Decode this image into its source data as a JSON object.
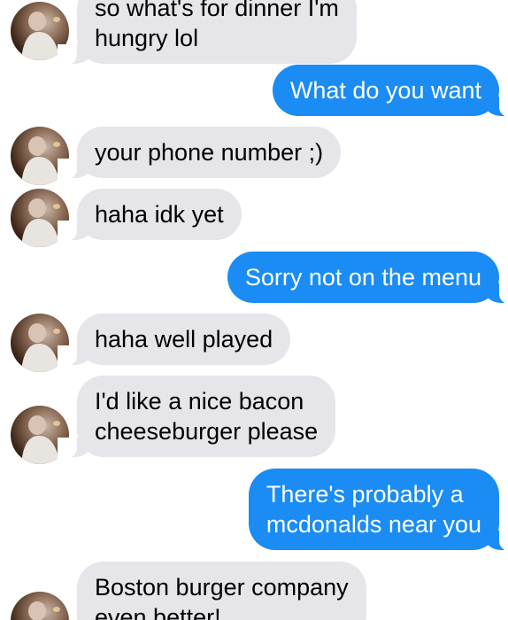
{
  "messages": [
    {
      "direction": "incoming",
      "avatar_icon": "contact-avatar",
      "lines": [
        "so what's for dinner I'm",
        "hungry lol"
      ]
    },
    {
      "direction": "outgoing",
      "lines": [
        "What do you want"
      ]
    },
    {
      "direction": "incoming",
      "avatar_icon": "contact-avatar",
      "lines": [
        "your phone number ;)"
      ]
    },
    {
      "direction": "incoming",
      "avatar_icon": "contact-avatar",
      "lines": [
        "haha idk yet"
      ]
    },
    {
      "direction": "outgoing",
      "lines": [
        "Sorry not on the menu"
      ]
    },
    {
      "direction": "incoming",
      "avatar_icon": "contact-avatar",
      "lines": [
        "haha well played"
      ]
    },
    {
      "direction": "incoming",
      "avatar_icon": "contact-avatar",
      "lines": [
        "I'd like a nice bacon",
        "cheeseburger please"
      ]
    },
    {
      "direction": "outgoing",
      "lines": [
        "There's probably a",
        "mcdonalds near you"
      ]
    },
    {
      "direction": "incoming",
      "avatar_icon": "contact-avatar",
      "lines": [
        "Boston burger company",
        "even better!"
      ]
    }
  ],
  "colors": {
    "incoming_bubble": "#e5e5ea",
    "outgoing_bubble": "#1a8cf4",
    "outgoing_text": "#ffffff",
    "incoming_text": "#000000"
  }
}
